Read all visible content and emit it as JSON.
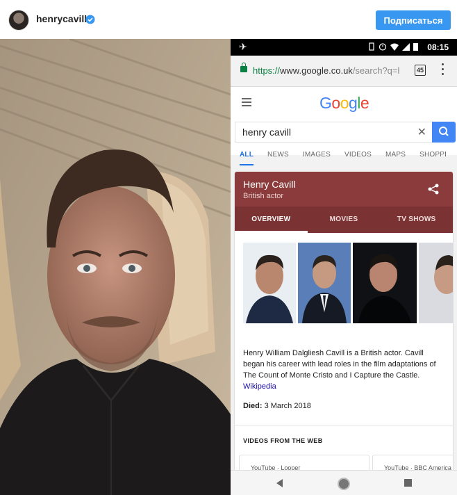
{
  "instagram": {
    "username": "henrycavill",
    "verified": true,
    "follow_label": "Подписаться",
    "accent_color": "#3897f0"
  },
  "phone": {
    "status_time": "08:15",
    "status_icons": [
      "airplane-mode-icon",
      "vibrate-icon",
      "alarm-icon",
      "wifi-icon",
      "signal-icon",
      "battery-icon"
    ],
    "url_https": "https://",
    "url_domain": "www.google.co.uk",
    "url_path": "/search?q=l",
    "tabs_count": "45",
    "logo": "Google",
    "search_query": "henry cavill",
    "search_tabs": [
      {
        "label": "ALL",
        "active": true
      },
      {
        "label": "NEWS"
      },
      {
        "label": "IMAGES"
      },
      {
        "label": "VIDEOS"
      },
      {
        "label": "MAPS"
      },
      {
        "label": "SHOPPI"
      }
    ],
    "knowledge_panel": {
      "name": "Henry Cavill",
      "subtitle": "British actor",
      "header_color": "#8b3b3b",
      "tabs": [
        {
          "label": "OVERVIEW",
          "active": true
        },
        {
          "label": "MOVIES"
        },
        {
          "label": "TV SHOWS"
        }
      ],
      "description": "Henry William Dalgliesh Cavill is a British actor. Cavill began his career with lead roles in the film adaptations of The Count of Monte Cristo and I Capture the Castle.",
      "source_link": "Wikipedia",
      "died_label": "Died:",
      "died_value": "3 March 2018",
      "videos_heading": "VIDEOS FROM THE WEB",
      "video_cards": [
        "YouTube · Looper",
        "YouTube · BBC America"
      ]
    }
  }
}
